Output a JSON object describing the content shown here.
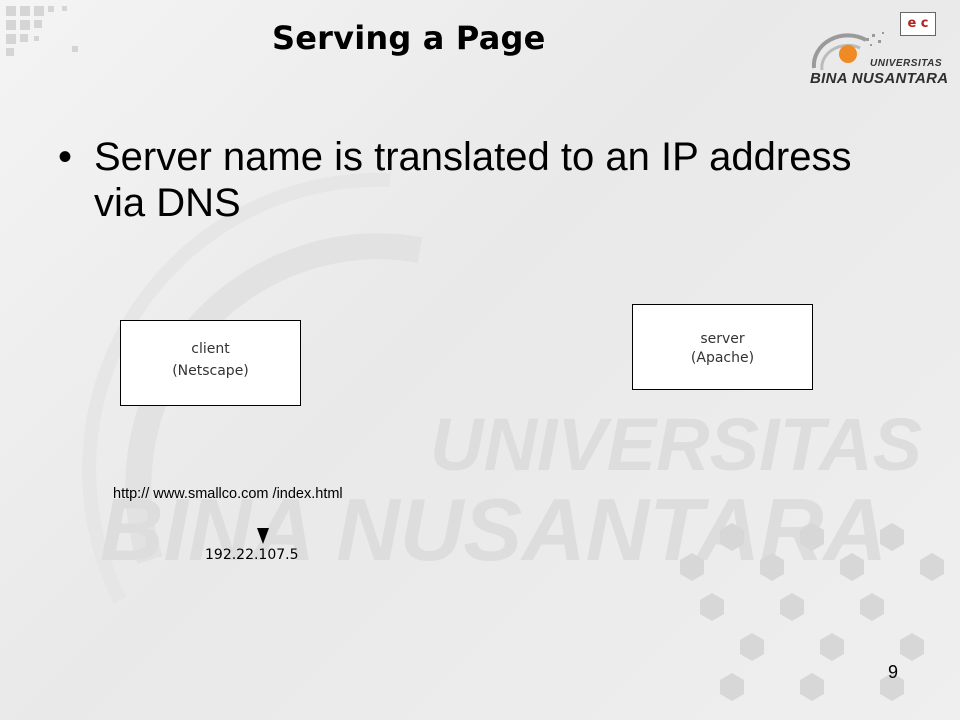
{
  "slide": {
    "title": "Serving a Page",
    "bullet_symbol": "•",
    "bullet_text": "Server name is translated to an IP address via DNS",
    "page_number": "9"
  },
  "logo": {
    "badge_text": "e c",
    "university_label": "UNIVERSITAS",
    "name": "BINA NUSANTARA"
  },
  "watermark": {
    "line1": "UNIVERSITAS",
    "line2": "BINA NUSANTARA"
  },
  "diagram": {
    "client": {
      "line1": "client",
      "line2": "(Netscape)"
    },
    "server": {
      "line1": "server",
      "line2": "(Apache)"
    },
    "url": "http:// www.smallco.com /index.html",
    "ip": "192.22.107.5"
  },
  "colors": {
    "text": "#000000",
    "box_fill": "#ffffff",
    "watermark": "#dcdcdc",
    "logo_orange": "#f08a24"
  }
}
